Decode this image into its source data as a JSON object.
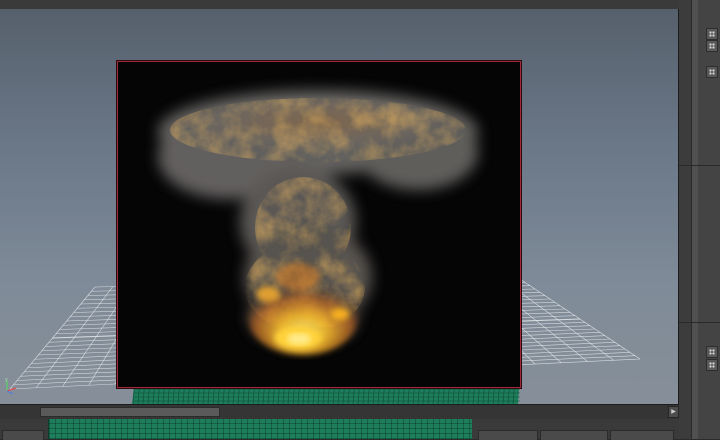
{
  "app": {
    "view": "perspective-viewport",
    "panel": "render-view"
  },
  "viewport": {
    "background_top": "#56606c",
    "background_bottom": "#868f99",
    "grid_color": "#e6e9ec",
    "ground_mesh_color": "#1d7e5c",
    "axis_labels": {
      "y": "y",
      "x": "x",
      "z": "z"
    }
  },
  "render_frame": {
    "border_color": "#a02a3a",
    "background": "#050506",
    "content": "fluid-explosion-render"
  },
  "colors": {
    "fire_core": "#ffcc33",
    "fire_mid": "#e08a1e",
    "smoke": "#6f6e6c",
    "panel_bg": "#444444"
  },
  "scrollbar": {
    "left_arrow": "◀",
    "right_arrow": "▶",
    "corner_left": "◀",
    "corner_right": "▶"
  }
}
